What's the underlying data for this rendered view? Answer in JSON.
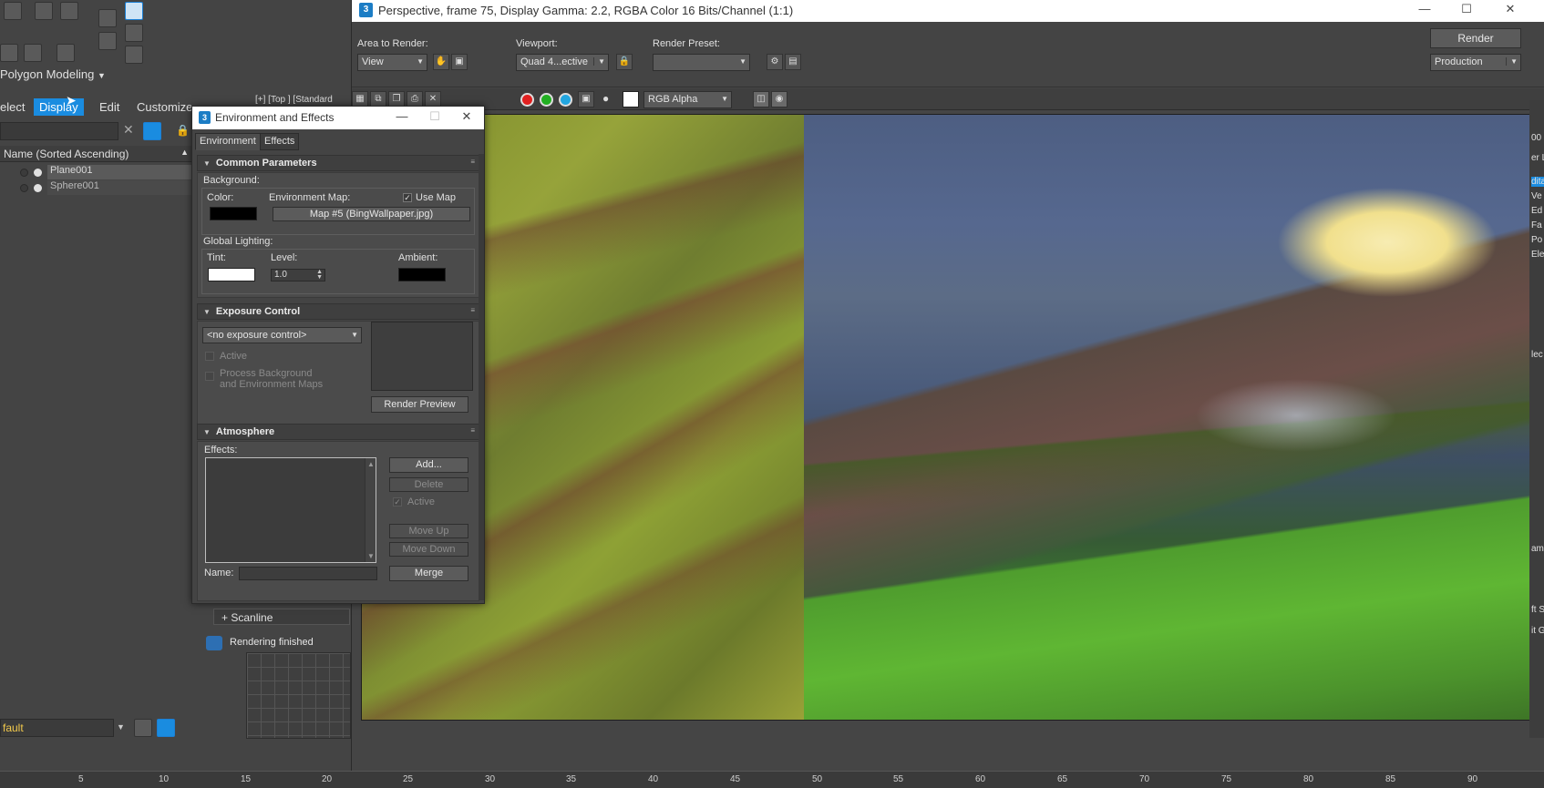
{
  "main_ui": {
    "ribbon_label": "Polygon Modeling",
    "menu": [
      "elect",
      "Display",
      "Edit",
      "Customize"
    ],
    "scene_explorer": {
      "header": "Name (Sorted Ascending)",
      "items": [
        "Plane001",
        "Sphere001"
      ]
    },
    "layer_field": "fault",
    "viewport_label": "[+] [Top ] [Standard",
    "ruler_ticks": [
      "5",
      "10",
      "15",
      "20",
      "25",
      "30",
      "35",
      "40",
      "45",
      "50",
      "55",
      "60",
      "65",
      "70",
      "75",
      "80",
      "85",
      "90"
    ],
    "right_strip": [
      "00",
      "er L",
      "dita",
      "Ve",
      "Ed",
      "Fa",
      "Po",
      "Ele",
      "lec",
      "ame",
      "ft S",
      "it G"
    ],
    "scanline": "+ Scanline",
    "status": "Rendering finished"
  },
  "render_window": {
    "title": "Perspective, frame 75, Display Gamma: 2.2, RGBA Color 16 Bits/Channel (1:1)",
    "area_label": "Area to Render:",
    "area_value": "View",
    "viewport_label": "Viewport:",
    "viewport_value": "Quad 4...ective",
    "preset_label": "Render Preset:",
    "preset_value": "",
    "render_button": "Render",
    "production_value": "Production",
    "channel_display": "RGB Alpha"
  },
  "dialog": {
    "title": "Environment and Effects",
    "tabs": [
      "Environment",
      "Effects"
    ],
    "common": {
      "header": "Common Parameters",
      "background_label": "Background:",
      "color_label": "Color:",
      "env_map_label": "Environment Map:",
      "use_map_label": "Use Map",
      "map_button": "Map #5 (BingWallpaper.jpg)",
      "global_lighting_label": "Global Lighting:",
      "tint_label": "Tint:",
      "level_label": "Level:",
      "level_value": "1.0",
      "ambient_label": "Ambient:"
    },
    "exposure": {
      "header": "Exposure Control",
      "dropdown": "<no exposure control>",
      "active_label": "Active",
      "process_label_1": "Process Background",
      "process_label_2": "and Environment Maps",
      "render_preview": "Render Preview"
    },
    "atmosphere": {
      "header": "Atmosphere",
      "effects_label": "Effects:",
      "add": "Add...",
      "delete": "Delete",
      "active_label": "Active",
      "move_up": "Move Up",
      "move_down": "Move Down",
      "name_label": "Name:",
      "merge": "Merge"
    }
  },
  "colors": {
    "accent": "#1a8ce0",
    "background_swatch": "#000000",
    "tint_swatch": "#ffffff",
    "ambient_swatch": "#000000",
    "layer_text": "#f2c94c"
  }
}
